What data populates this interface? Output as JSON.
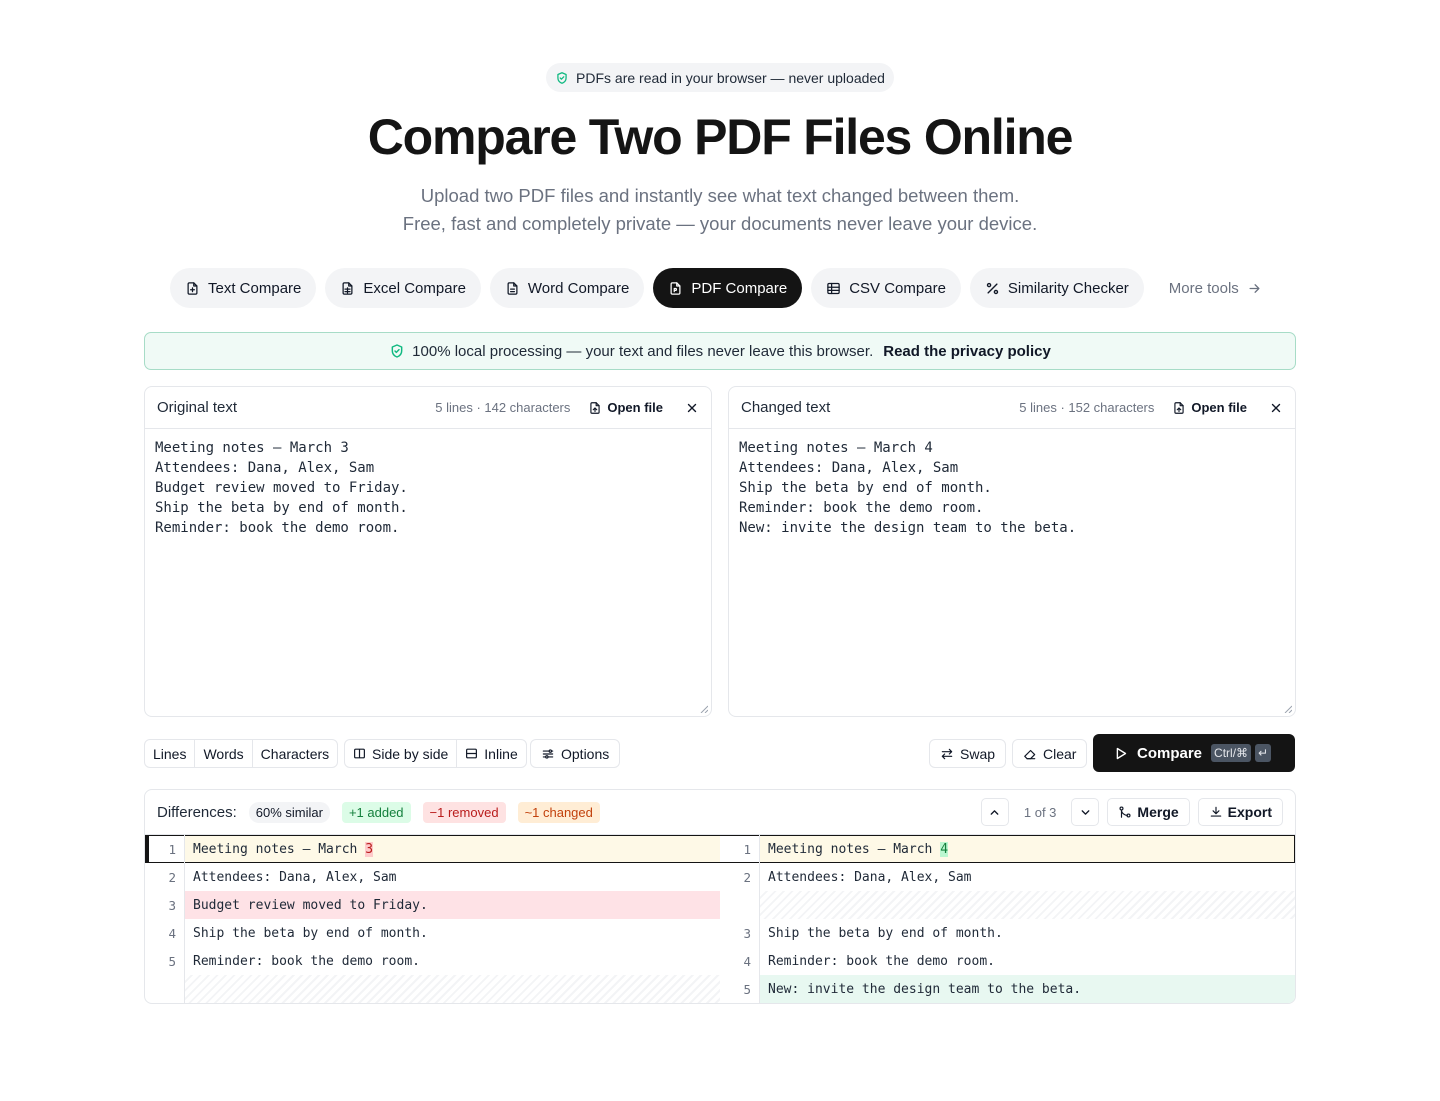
{
  "top_badge": "PDFs are read in your browser — never uploaded",
  "hero": {
    "title": "Compare Two PDF Files Online",
    "subtitle_line1": "Upload two PDF files and instantly see what text changed between them.",
    "subtitle_line2": "Free, fast and completely private — your documents never leave your device."
  },
  "tools": [
    {
      "label": "Text Compare",
      "icon": "text-file-icon"
    },
    {
      "label": "Excel Compare",
      "icon": "spreadsheet-file-icon"
    },
    {
      "label": "Word Compare",
      "icon": "document-file-icon"
    },
    {
      "label": "PDF Compare",
      "icon": "pdf-file-icon",
      "active": true
    },
    {
      "label": "CSV Compare",
      "icon": "table-icon"
    },
    {
      "label": "Similarity Checker",
      "icon": "percent-icon"
    }
  ],
  "more_tools": "More tools",
  "privacy": {
    "text": "100% local processing — your text and files never leave this browser.",
    "link": "Read the privacy policy"
  },
  "original": {
    "title": "Original text",
    "stats": "5 lines · 142 characters",
    "open_file": "Open file",
    "content": "Meeting notes — March 3\nAttendees: Dana, Alex, Sam\nBudget review moved to Friday.\nShip the beta by end of month.\nReminder: book the demo room."
  },
  "changed": {
    "title": "Changed text",
    "stats": "5 lines · 152 characters",
    "open_file": "Open file",
    "content": "Meeting notes — March 4\nAttendees: Dana, Alex, Sam\nShip the beta by end of month.\nReminder: book the demo room.\nNew: invite the design team to the beta."
  },
  "granularity": [
    "Lines",
    "Words",
    "Characters"
  ],
  "view_modes": [
    "Side by side",
    "Inline"
  ],
  "options_label": "Options",
  "swap_label": "Swap",
  "clear_label": "Clear",
  "compare": {
    "label": "Compare",
    "shortcut": "Ctrl/⌘",
    "enter": "↵"
  },
  "diff": {
    "label": "Differences:",
    "similar": "60% similar",
    "added": "+1 added",
    "removed": "−1 removed",
    "changed": "~1 changed",
    "pager": "1 of 3",
    "merge": "Merge",
    "export": "Export",
    "rows": [
      {
        "l_num": "1",
        "l_pre": "Meeting notes — March ",
        "l_hl": "3",
        "r_num": "1",
        "r_pre": "Meeting notes — March ",
        "r_hl": "4"
      },
      {
        "l_num": "2",
        "l_text": "Attendees: Dana, Alex, Sam",
        "r_num": "2",
        "r_text": "Attendees: Dana, Alex, Sam"
      },
      {
        "l_num": "3",
        "l_text": "Budget review moved to Friday."
      },
      {
        "l_num": "4",
        "l_text": "Ship the beta by end of month.",
        "r_num": "3",
        "r_text": "Ship the beta by end of month."
      },
      {
        "l_num": "5",
        "l_text": "Reminder: book the demo room.",
        "r_num": "4",
        "r_text": "Reminder: book the demo room."
      },
      {
        "r_num": "5",
        "r_text": "New: invite the design team to the beta."
      }
    ]
  },
  "colors": {
    "accent": "#141414",
    "added": "#15803d",
    "removed": "#b91c1c",
    "changed": "#c2410c"
  }
}
